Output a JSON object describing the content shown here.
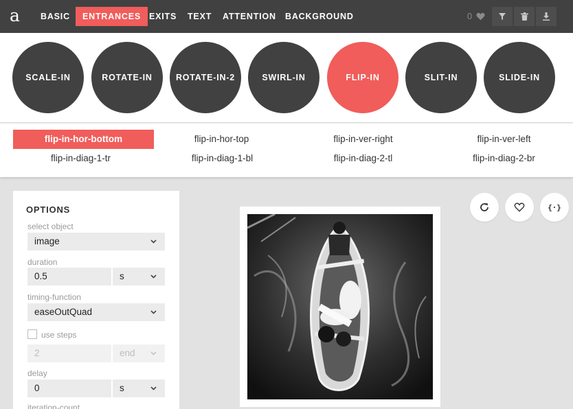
{
  "logo": "a",
  "nav": {
    "tabs": [
      {
        "label": "BASIC"
      },
      {
        "label": "ENTRANCES",
        "active": true
      },
      {
        "label": "EXITS"
      },
      {
        "label": "TEXT"
      },
      {
        "label": "ATTENTION"
      },
      {
        "label": "BACKGROUND"
      }
    ],
    "likes_count": "0",
    "icons": [
      "heart-icon",
      "filter-icon",
      "trash-icon",
      "download-icon"
    ]
  },
  "animations": [
    {
      "label": "SCALE-IN"
    },
    {
      "label": "ROTATE-IN"
    },
    {
      "label": "ROTATE-IN-2"
    },
    {
      "label": "SWIRL-IN"
    },
    {
      "label": "FLIP-IN",
      "active": true
    },
    {
      "label": "SLIT-IN"
    },
    {
      "label": "SLIDE-IN"
    }
  ],
  "variants": [
    {
      "label": "flip-in-hor-bottom",
      "active": true
    },
    {
      "label": "flip-in-hor-top"
    },
    {
      "label": "flip-in-ver-right"
    },
    {
      "label": "flip-in-ver-left"
    },
    {
      "label": "flip-in-diag-1-tr"
    },
    {
      "label": "flip-in-diag-1-bl"
    },
    {
      "label": "flip-in-diag-2-tl"
    },
    {
      "label": "flip-in-diag-2-br"
    }
  ],
  "options": {
    "title": "OPTIONS",
    "select_object_label": "select object",
    "select_object_value": "image",
    "duration_label": "duration",
    "duration_value": "0.5",
    "duration_unit": "s",
    "timing_label": "timing-function",
    "timing_value": "easeOutQuad",
    "use_steps_label": "use steps",
    "use_steps_checked": false,
    "steps_value": "2",
    "steps_position": "end",
    "delay_label": "delay",
    "delay_value": "0",
    "delay_unit": "s",
    "iteration_label": "iteration-count"
  },
  "actions": {
    "replay_icon": "replay-icon",
    "favorite_icon": "heart-icon",
    "code_label": "{·}"
  },
  "colors": {
    "accent": "#f05d5b",
    "dark": "#414141",
    "background": "#e2e2e2"
  }
}
